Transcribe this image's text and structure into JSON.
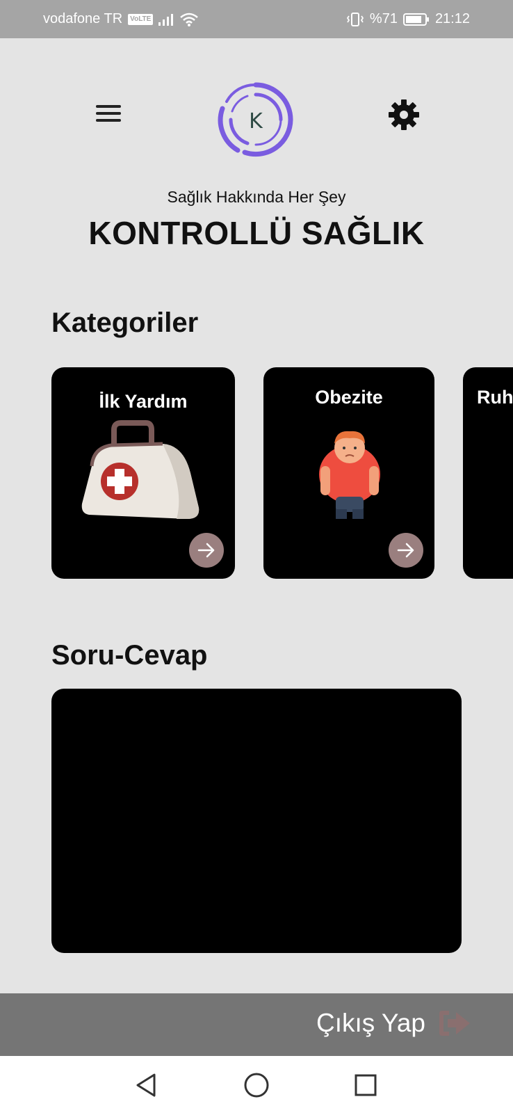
{
  "status_bar": {
    "carrier": "vodafone TR",
    "volte": "VoLTE",
    "battery": "%71",
    "time": "21:12"
  },
  "header": {
    "logo_letter": "K",
    "tagline": "Sağlık Hakkında Her Şey",
    "title": "KONTROLLÜ SAĞLIK"
  },
  "categories": {
    "heading": "Kategoriler",
    "items": [
      {
        "label": "İlk Yardım",
        "illustration": "first-aid-bag"
      },
      {
        "label": "Obezite",
        "illustration": "overweight-person"
      },
      {
        "label": "Ruh",
        "illustration": ""
      }
    ]
  },
  "qa": {
    "heading": "Soru-Cevap"
  },
  "logout": {
    "label": "Çıkış Yap",
    "icon": "logout-icon"
  },
  "colors": {
    "background": "#e4e4e4",
    "card": "#000000",
    "arrow_button": "#9a7f7f",
    "logo_purple": "#7a5ce0",
    "logout_bar": "#757575",
    "logout_icon": "#8a6f6f"
  }
}
